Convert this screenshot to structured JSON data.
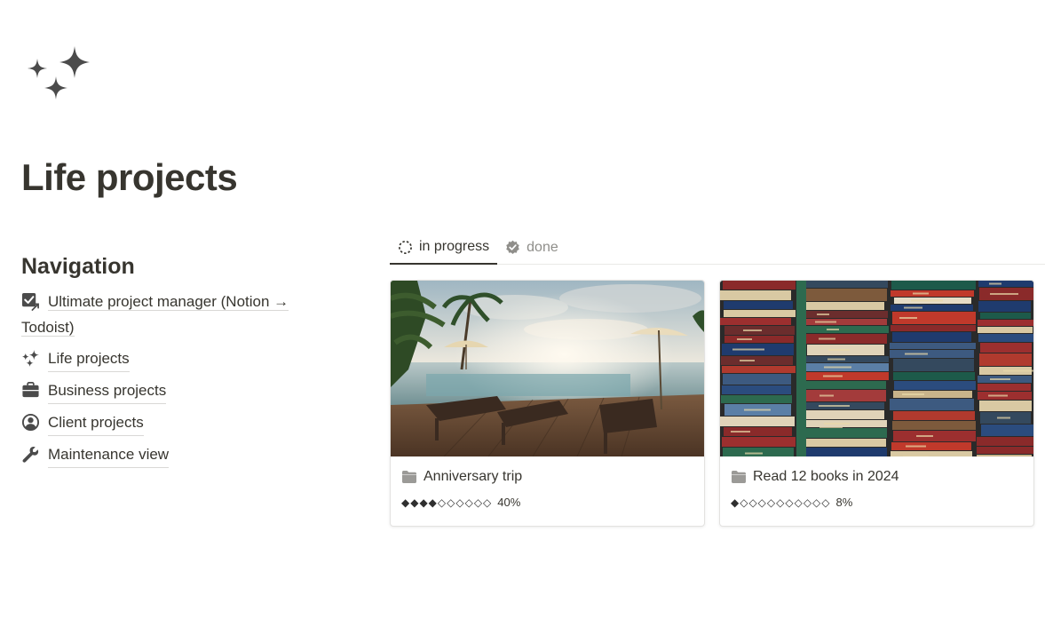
{
  "page": {
    "title": "Life projects",
    "icon": "sparkles-icon"
  },
  "navigation": {
    "heading": "Navigation",
    "items": [
      {
        "label": "Ultimate project manager (Notion → Todoist)",
        "icon": "checkbox-arrow-icon"
      },
      {
        "label": "Life projects",
        "icon": "sparkles-icon"
      },
      {
        "label": "Business projects",
        "icon": "briefcase-icon"
      },
      {
        "label": "Client projects",
        "icon": "user-circle-icon"
      },
      {
        "label": "Maintenance view",
        "icon": "wrench-icon"
      }
    ]
  },
  "tabs": [
    {
      "label": "in progress",
      "icon": "dashed-circle-icon",
      "active": true
    },
    {
      "label": "done",
      "icon": "verified-check-icon",
      "active": false
    }
  ],
  "cards": [
    {
      "title": "Anniversary trip",
      "icon": "folder-icon",
      "progress_bar": "◆◆◆◆◇◇◇◇◇◇",
      "progress_value": 40,
      "progress_label": "40%",
      "cover": "tropical-pool-photo"
    },
    {
      "title": "Read 12 books in 2024",
      "icon": "folder-icon",
      "progress_bar": "◆◇◇◇◇◇◇◇◇◇◇",
      "progress_value": 8,
      "progress_label": "8%",
      "cover": "stacked-books-photo"
    }
  ],
  "colors": {
    "text": "#37352f",
    "muted": "#8f8e8a",
    "icon": "#4b4b4b"
  }
}
